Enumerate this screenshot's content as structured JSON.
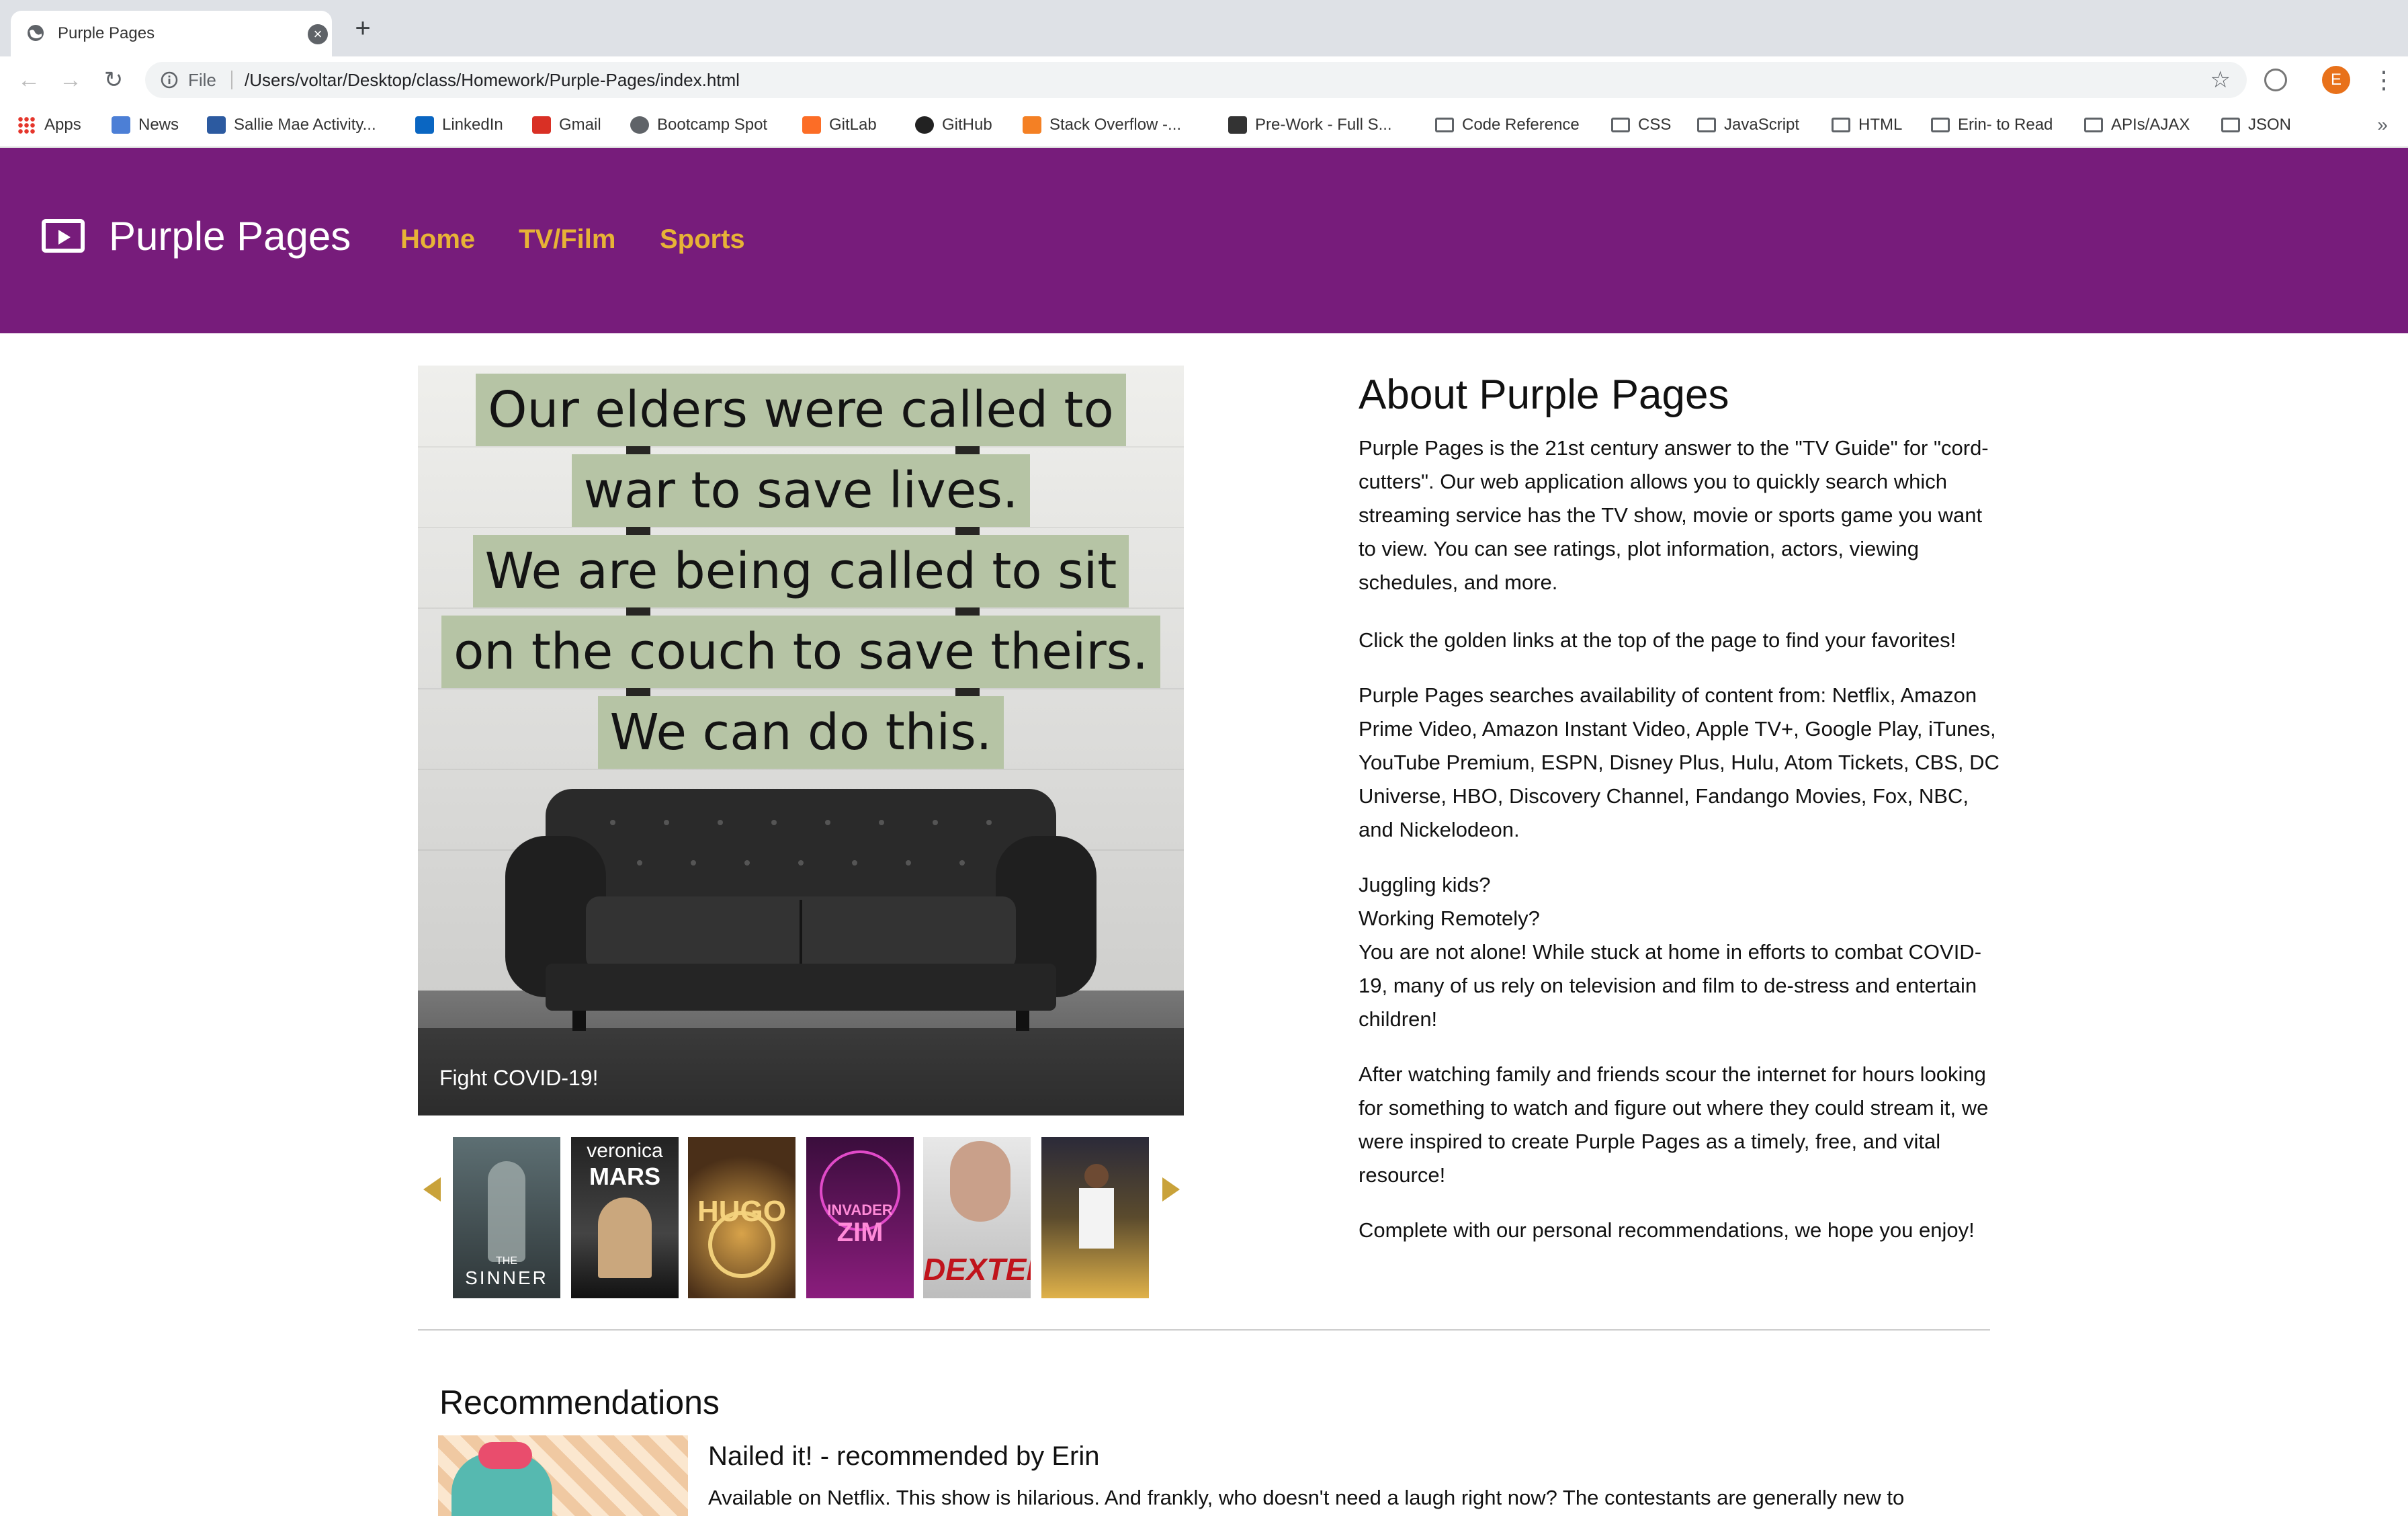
{
  "browser": {
    "tab_title": "Purple Pages",
    "close_glyph": "×",
    "new_tab_glyph": "+",
    "back_glyph": "←",
    "forward_glyph": "→",
    "reload_glyph": "↻",
    "scheme_label": "File",
    "url": "/Users/voltar/Desktop/class/Homework/Purple-Pages/index.html",
    "star_glyph": "☆",
    "profile_initial": "E",
    "menu_glyph": "⋮",
    "more_glyph": "»"
  },
  "bookmarks": [
    {
      "label": "Apps",
      "icon": "apps-grid-icon"
    },
    {
      "label": "News",
      "icon": "news-icon"
    },
    {
      "label": "Sallie Mae Activity...",
      "icon": "sallie-mae-icon"
    },
    {
      "label": "LinkedIn",
      "icon": "linkedin-icon"
    },
    {
      "label": "Gmail",
      "icon": "gmail-icon"
    },
    {
      "label": "Bootcamp Spot",
      "icon": "globe-icon"
    },
    {
      "label": "GitLab",
      "icon": "gitlab-icon"
    },
    {
      "label": "GitHub",
      "icon": "github-icon"
    },
    {
      "label": "Stack Overflow -...",
      "icon": "stackoverflow-icon"
    },
    {
      "label": "Pre-Work  - Full S...",
      "icon": "book-icon"
    },
    {
      "label": "Code Reference",
      "icon": "folder-icon"
    },
    {
      "label": "CSS",
      "icon": "folder-icon"
    },
    {
      "label": "JavaScript",
      "icon": "folder-icon"
    },
    {
      "label": "HTML",
      "icon": "folder-icon"
    },
    {
      "label": "Erin- to Read",
      "icon": "folder-icon"
    },
    {
      "label": "APIs/AJAX",
      "icon": "folder-icon"
    },
    {
      "label": "JSON",
      "icon": "folder-icon"
    }
  ],
  "site": {
    "brand": "Purple Pages",
    "nav": [
      "Home",
      "TV/Film",
      "Sports"
    ],
    "colors": {
      "nav_bg": "#771c7b",
      "link": "#e7b336",
      "arrow": "#c9a23a"
    }
  },
  "hero": {
    "quote_lines": [
      "Our elders were called to",
      "war to save lives.",
      "We are being called to sit",
      "on the couch to save theirs.",
      "We can do this."
    ],
    "caption": "Fight COVID-19!"
  },
  "carousel": {
    "posters": [
      {
        "name": "the-sinner-poster",
        "label": "SINNER",
        "sub": "THE"
      },
      {
        "name": "veronica-mars-poster",
        "label": "MARS",
        "sub": "veronica"
      },
      {
        "name": "hugo-poster",
        "label": "HUGO",
        "sub": ""
      },
      {
        "name": "invader-zim-poster",
        "label": "ZIM",
        "sub": "INVADER"
      },
      {
        "name": "dexter-poster",
        "label": "DEXTER",
        "sub": ""
      },
      {
        "name": "basketball-poster",
        "label": "",
        "sub": ""
      }
    ]
  },
  "about": {
    "title": "About Purple Pages",
    "paragraphs": [
      "Purple Pages is the 21st century answer to the \"TV Guide\" for \"cord-cutters\". Our web application allows you to quickly search which streaming service has the TV show, movie or sports game you want to view. You can see ratings, plot information, actors, viewing schedules, and more.",
      "Click the golden links at the top of the page to find your favorites!",
      "Purple Pages searches availability of content from: Netflix, Amazon Prime Video, Amazon Instant Video, Apple TV+, Google Play, iTunes, YouTube Premium, ESPN, Disney Plus, Hulu, Atom Tickets, CBS, DC Universe, HBO, Discovery Channel, Fandango Movies, Fox, NBC, and Nickelodeon.",
      "Juggling kids?",
      "Working Remotely?",
      "You are not alone! While stuck at home in efforts to combat COVID-19, many of us rely on television and film to de-stress and entertain children!",
      "After watching family and friends scour the internet for hours looking for something to watch and figure out where they could stream it, we were inspired to create Purple Pages as a timely, free, and vital resource!",
      "Complete with our personal recommendations, we hope you enjoy!"
    ]
  },
  "recommendations": {
    "title": "Recommendations",
    "items": [
      {
        "title": "Nailed it! - recommended by Erin",
        "text": "Available on Netflix. This show is hilarious. And frankly, who doesn't need a laugh right now? The contestants are generally new to"
      }
    ]
  }
}
